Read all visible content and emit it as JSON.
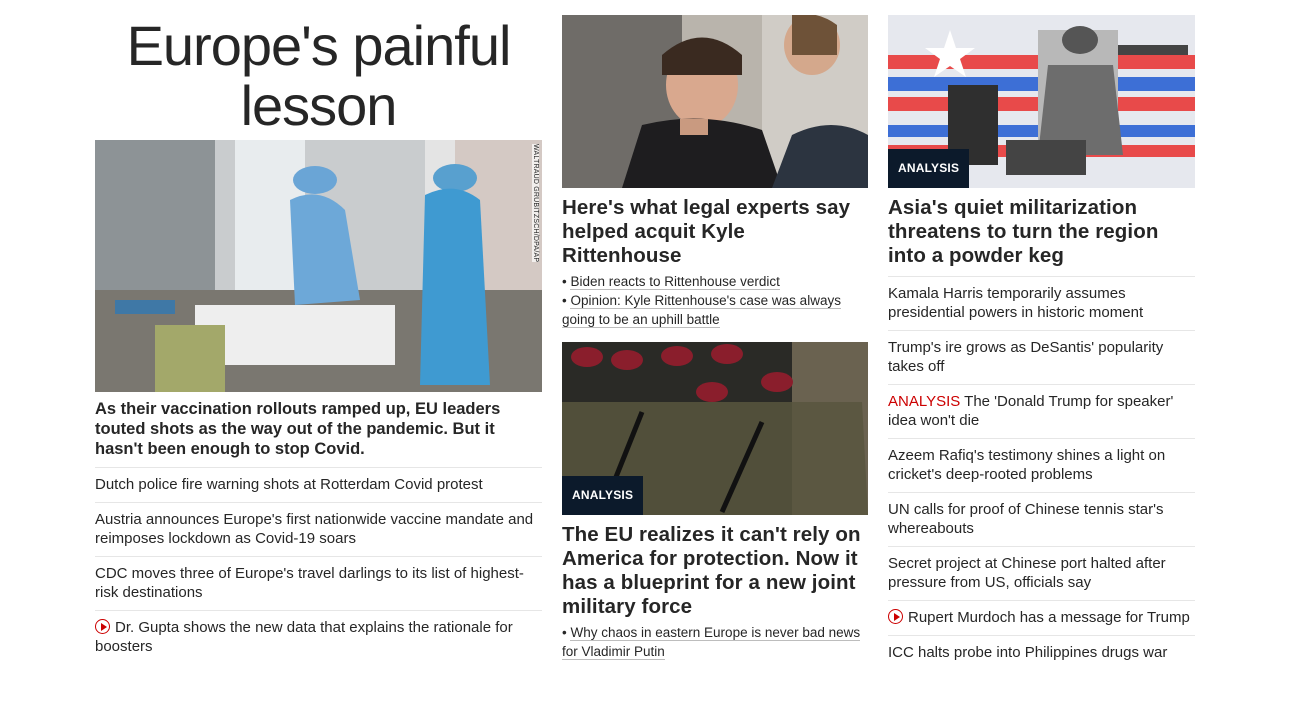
{
  "column1": {
    "title": "Europe's painful lesson",
    "image_credit": "WALTRAUD GRUBITZSCH/DPA/AP",
    "lead": "As their vaccination rollouts ramped up, EU leaders touted shots as the way out of the pandemic. But it hasn't been enough to stop Covid.",
    "items": [
      {
        "text": "Dutch police fire warning shots at Rotterdam Covid protest"
      },
      {
        "text": "Austria announces Europe's first nationwide vaccine mandate and reimposes lockdown as Covid-19 soars"
      },
      {
        "text": "CDC moves three of Europe's travel darlings to its list of highest-risk destinations"
      },
      {
        "text": "Dr. Gupta shows the new data that explains the rationale for boosters",
        "icon": "play-icon"
      }
    ]
  },
  "column2": {
    "story1": {
      "headline": "Here's what legal experts say helped acquit Kyle Rittenhouse",
      "subs": [
        "Biden reacts to Rittenhouse verdict",
        "Opinion: Kyle Rittenhouse's case was always going to be an uphill battle"
      ]
    },
    "story2": {
      "badge": "ANALYSIS",
      "headline": "The EU realizes it can't rely on America for protection. Now it has a blueprint for a new joint military force",
      "subs": [
        "Why chaos in eastern Europe is never bad news for Vladimir Putin"
      ]
    }
  },
  "column3": {
    "badge": "ANALYSIS",
    "headline": "Asia's quiet militarization threatens to turn the region into a powder keg",
    "items": [
      {
        "text": "Kamala Harris temporarily assumes presidential powers in historic moment"
      },
      {
        "text": "Trump's ire grows as DeSantis' popularity takes off"
      },
      {
        "flag": "ANALYSIS",
        "text": "The 'Donald Trump for speaker' idea won't die"
      },
      {
        "text": "Azeem Rafiq's testimony shines a light on cricket's deep-rooted problems"
      },
      {
        "text": "UN calls for proof of Chinese tennis star's whereabouts"
      },
      {
        "text": "Secret project at Chinese port halted after pressure from US, officials say"
      },
      {
        "text": "Rupert Murdoch has a message for Trump",
        "icon": "play-icon"
      },
      {
        "text": "ICC halts probe into Philippines drugs war"
      }
    ]
  },
  "colors": {
    "badge_bg": "#0c1a2b",
    "flag_red": "#cc0000",
    "text": "#262626"
  }
}
